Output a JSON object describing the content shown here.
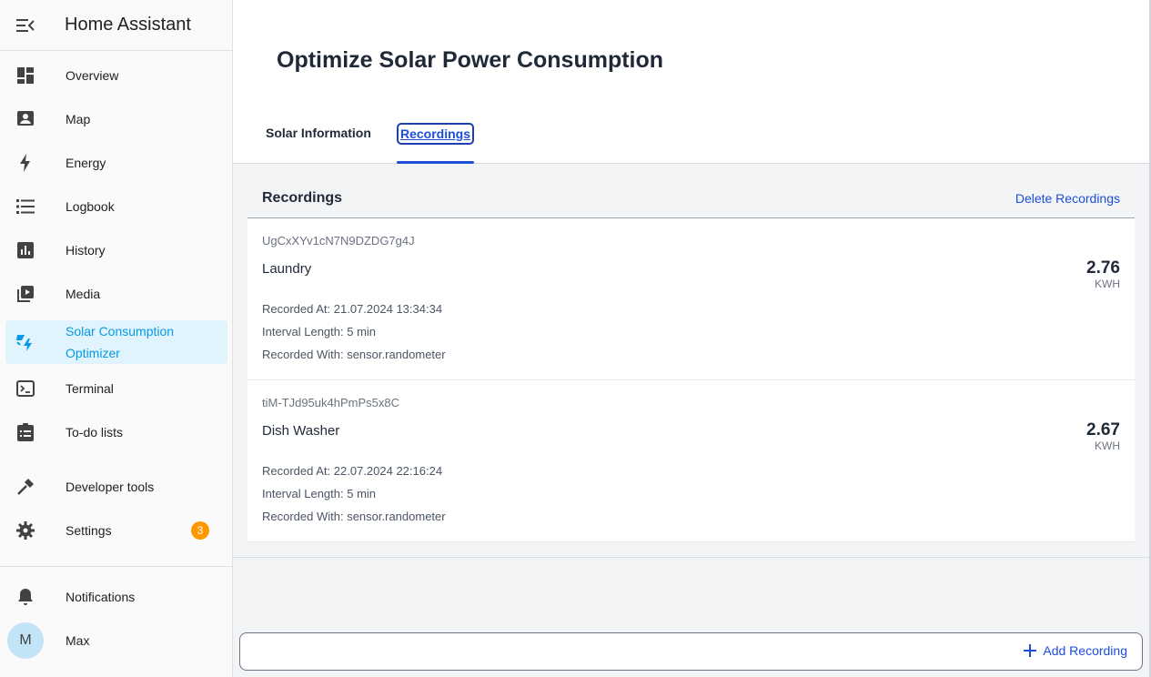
{
  "app": {
    "title": "Home Assistant"
  },
  "sidebar": {
    "items": [
      {
        "label": "Overview"
      },
      {
        "label": "Map"
      },
      {
        "label": "Energy"
      },
      {
        "label": "Logbook"
      },
      {
        "label": "History"
      },
      {
        "label": "Media"
      },
      {
        "label_line1": "Solar Consumption",
        "label_line2": "Optimizer",
        "active": true
      },
      {
        "label": "Terminal"
      },
      {
        "label": "To-do lists"
      },
      {
        "label": "Developer tools"
      },
      {
        "label": "Settings",
        "badge": "3"
      }
    ],
    "bottom": [
      {
        "label": "Notifications"
      },
      {
        "label": "Max",
        "avatar_initial": "M"
      }
    ]
  },
  "main": {
    "page_title": "Optimize Solar Power Consumption",
    "tabs": [
      {
        "label": "Solar Information"
      },
      {
        "label": "Recordings",
        "selected": true
      }
    ],
    "recordings": {
      "title": "Recordings",
      "delete_label": "Delete Recordings",
      "items": [
        {
          "id": "UgCxXYv1cN7N9DZDG7g4J",
          "name": "Laundry",
          "value": "2.76",
          "unit": "KWH",
          "recorded_at": "Recorded At: 21.07.2024 13:34:34",
          "interval": "Interval Length: 5 min",
          "recorded_with": "Recorded With: sensor.randometer"
        },
        {
          "id": "tiM-TJd95uk4hPmPs5x8C",
          "name": "Dish Washer",
          "value": "2.67",
          "unit": "KWH",
          "recorded_at": "Recorded At: 22.07.2024 22:16:24",
          "interval": "Interval Length: 5 min",
          "recorded_with": "Recorded With: sensor.randometer"
        }
      ]
    },
    "add_label": "Add Recording"
  },
  "colors": {
    "accent": "#039be5",
    "active_bg": "#e1f3fc",
    "link": "#1d4ed8",
    "badge": "#ff9800"
  }
}
